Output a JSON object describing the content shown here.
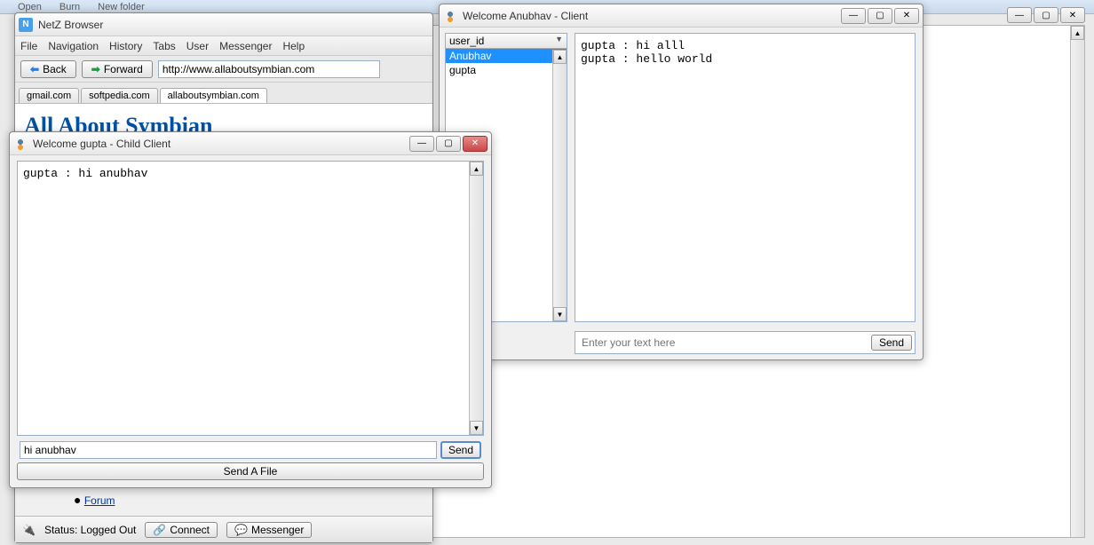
{
  "bg_toolbar": {
    "open": "Open",
    "burn": "Burn",
    "newfolder": "New folder"
  },
  "bg_right_buttons": {
    "min": "—",
    "max": "▢",
    "close": "✕"
  },
  "browser": {
    "title": "NetZ Browser",
    "menu": [
      "File",
      "Navigation",
      "History",
      "Tabs",
      "User",
      "Messenger",
      "Help"
    ],
    "back_label": "Back",
    "forward_label": "Forward",
    "url": "http://www.allaboutsymbian.com",
    "tabs": [
      "gmail.com",
      "softpedia.com",
      "allaboutsymbian.com"
    ],
    "active_tab": 2,
    "page_heading": "All About Symbian",
    "forum_link": "Forum",
    "status_text": "Status: Logged Out",
    "connect_btn": "Connect",
    "messenger_btn": "Messenger"
  },
  "anubhav": {
    "title": "Welcome Anubhav - Client",
    "list_header": "user_id",
    "users": [
      "Anubhav",
      "gupta"
    ],
    "selected": 0,
    "chat_lines": [
      "gupta : hi alll",
      "gupta : hello world"
    ],
    "placeholder": "Enter your text here",
    "send_label": "Send"
  },
  "gupta": {
    "title": "Welcome gupta - Child Client",
    "chat_lines": [
      "gupta : hi anubhav"
    ],
    "input_value": "hi anubhav",
    "send_label": "Send",
    "send_file_label": "Send A File"
  }
}
